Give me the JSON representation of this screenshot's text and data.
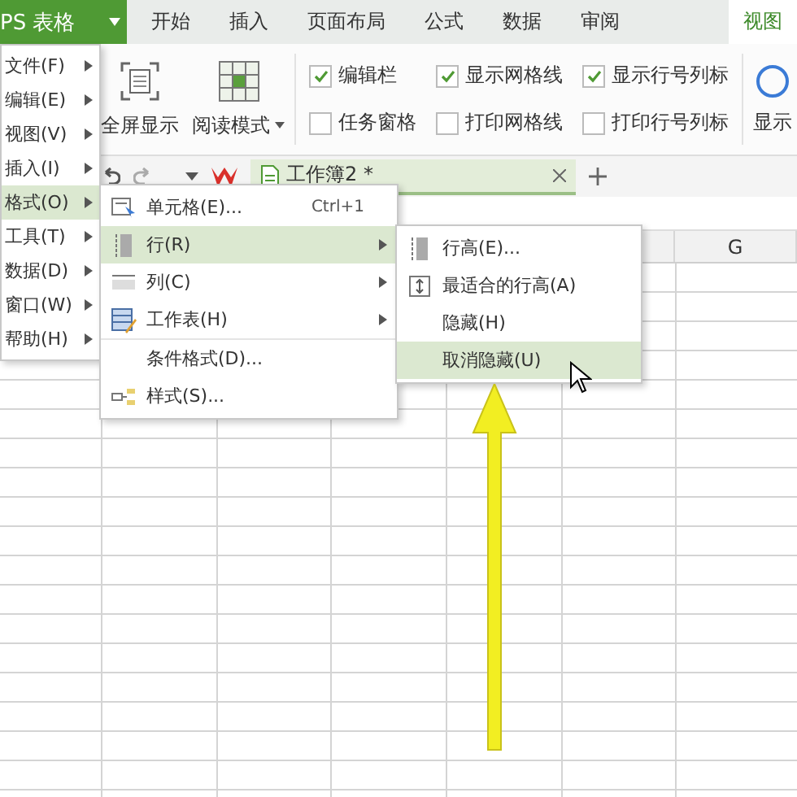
{
  "app_menu": {
    "label": "PS 表格"
  },
  "tabs": [
    {
      "label": "开始",
      "selected": false
    },
    {
      "label": "插入",
      "selected": false
    },
    {
      "label": "页面布局",
      "selected": false
    },
    {
      "label": "公式",
      "selected": false
    },
    {
      "label": "数据",
      "selected": false
    },
    {
      "label": "审阅",
      "selected": false
    },
    {
      "label": "视图",
      "selected": true
    }
  ],
  "ribbon": {
    "buttons": [
      {
        "label": "全屏显示",
        "kind": "fullscreen"
      },
      {
        "label": "阅读模式",
        "kind": "reading"
      }
    ],
    "checkbox_columns": [
      [
        {
          "label": "编辑栏",
          "checked": true
        },
        {
          "label": "任务窗格",
          "checked": false
        }
      ],
      [
        {
          "label": "显示网格线",
          "checked": true
        },
        {
          "label": "打印网格线",
          "checked": false
        }
      ],
      [
        {
          "label": "显示行号列标",
          "checked": true
        },
        {
          "label": "打印行号列标",
          "checked": false
        }
      ]
    ],
    "cut_button": {
      "label": "显示"
    }
  },
  "document_tab": {
    "title": "工作簿2 *"
  },
  "sheet": {
    "column_header": "G"
  },
  "main_menu": [
    {
      "label": "文件(F)",
      "selected": false
    },
    {
      "label": "编辑(E)",
      "selected": false
    },
    {
      "label": "视图(V)",
      "selected": false
    },
    {
      "label": "插入(I)",
      "selected": false
    },
    {
      "label": "格式(O)",
      "selected": true
    },
    {
      "label": "工具(T)",
      "selected": false
    },
    {
      "label": "数据(D)",
      "selected": false
    },
    {
      "label": "窗口(W)",
      "selected": false
    },
    {
      "label": "帮助(H)",
      "selected": false
    }
  ],
  "format_menu": [
    {
      "label": "单元格(E)...",
      "shortcut": "Ctrl+1",
      "kind": "cell",
      "submenu": false,
      "selected": false
    },
    {
      "label": "行(R)",
      "kind": "row",
      "submenu": true,
      "selected": true
    },
    {
      "label": "列(C)",
      "kind": "column",
      "submenu": true,
      "selected": false
    },
    {
      "label": "工作表(H)",
      "kind": "sheet",
      "submenu": true,
      "selected": false
    },
    {
      "label": "条件格式(D)...",
      "kind": "plain",
      "separator_before": true,
      "submenu": false,
      "selected": false
    },
    {
      "label": "样式(S)...",
      "kind": "style",
      "submenu": false,
      "selected": false
    }
  ],
  "row_menu": [
    {
      "label": "行高(E)...",
      "kind": "height",
      "selected": false
    },
    {
      "label": "最适合的行高(A)",
      "kind": "autofit",
      "selected": false
    },
    {
      "label": "隐藏(H)",
      "kind": "plain",
      "selected": false
    },
    {
      "label": "取消隐藏(U)",
      "kind": "plain",
      "selected": true
    }
  ]
}
